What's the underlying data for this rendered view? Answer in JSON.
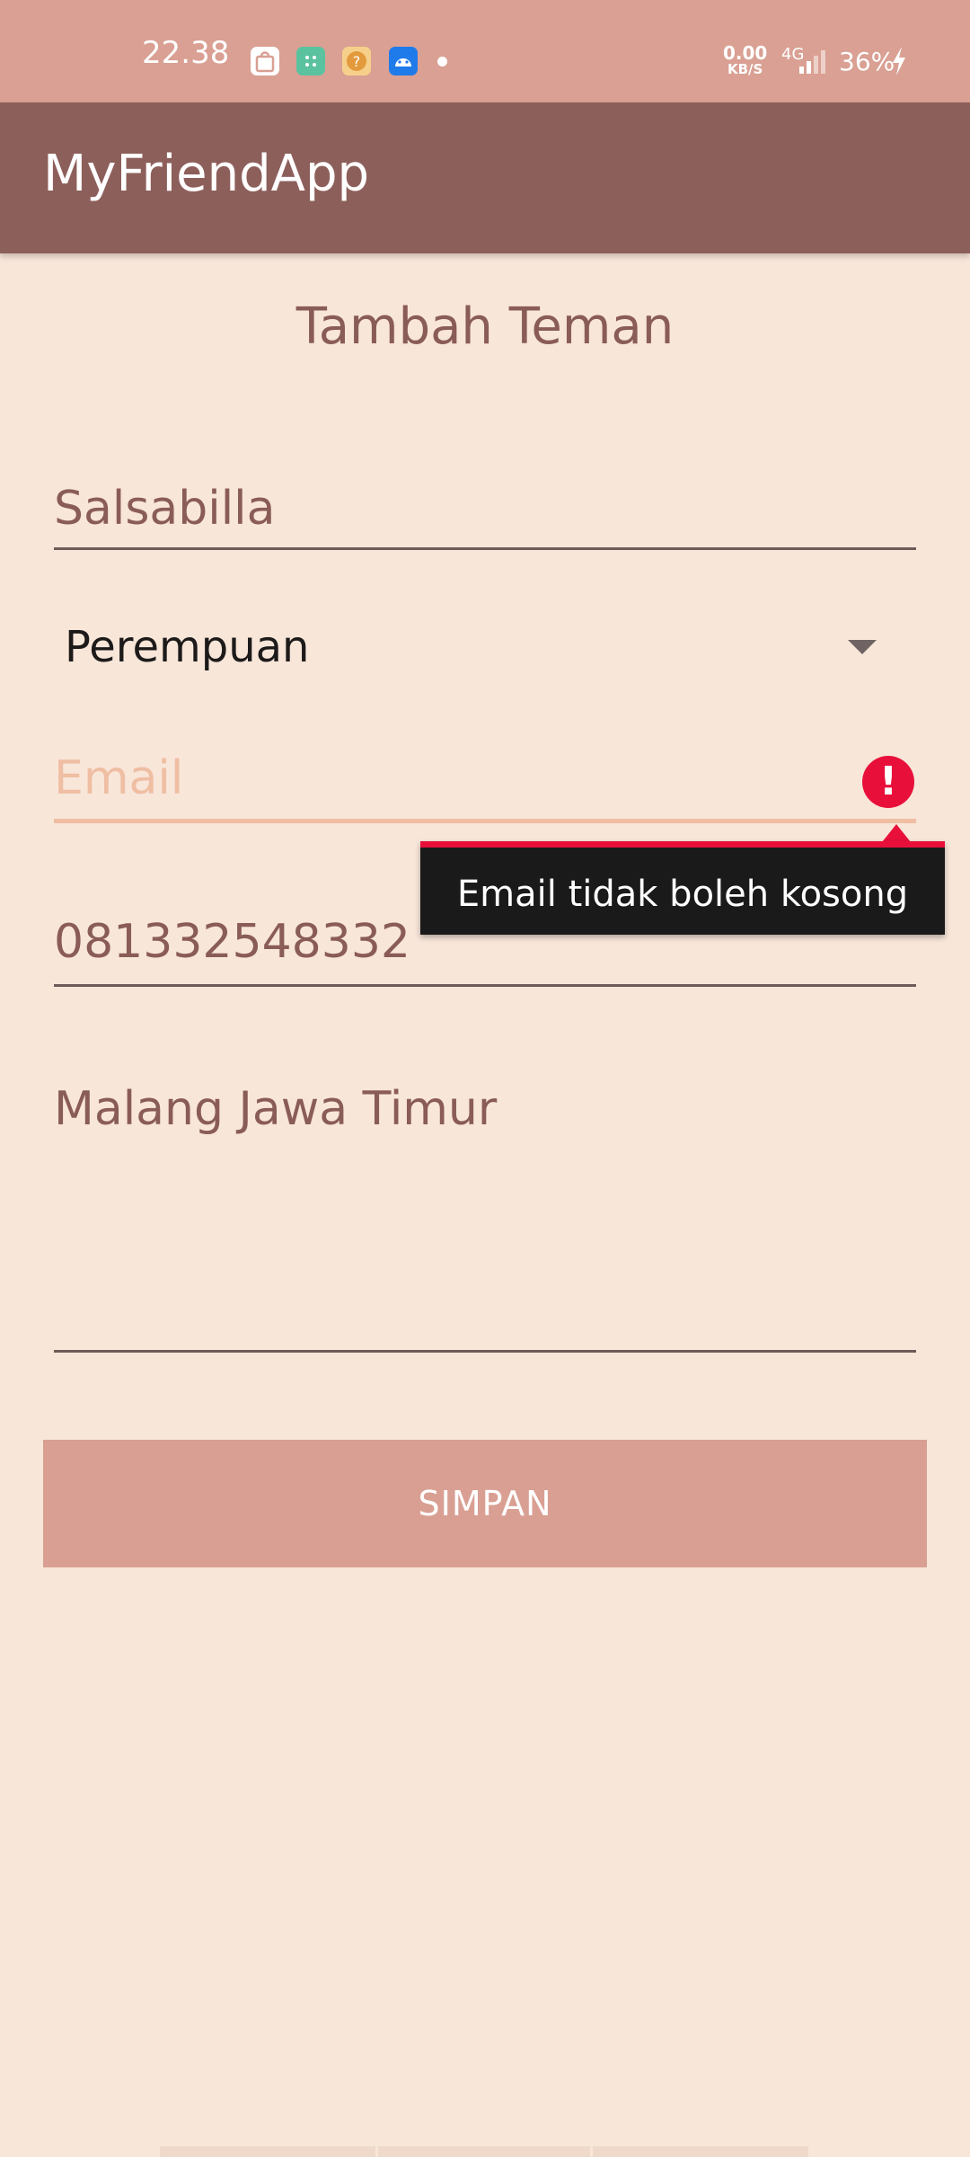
{
  "status_bar": {
    "time": "22.38",
    "net_speed_value": "0.00",
    "net_speed_unit": "KB/S",
    "network_type": "4G",
    "battery": "36%",
    "icons": [
      "shopee-icon",
      "app-icon",
      "game-icon",
      "android-icon"
    ]
  },
  "app_bar": {
    "title": "MyFriendApp",
    "color": "#8d5f5b"
  },
  "form": {
    "title": "Tambah Teman",
    "name_value": "Salsabilla",
    "gender_value": "Perempuan",
    "email_placeholder": "Email",
    "email_error": "Email tidak boleh kosong",
    "phone_value": "081332548332",
    "address_value": "Malang Jawa Timur",
    "save_label": "SIMPAN"
  },
  "colors": {
    "background": "#f8e6d9",
    "status_bar": "#d9a093",
    "accent": "#d99f93",
    "text": "#8a5c57",
    "error": "#e8103a"
  }
}
